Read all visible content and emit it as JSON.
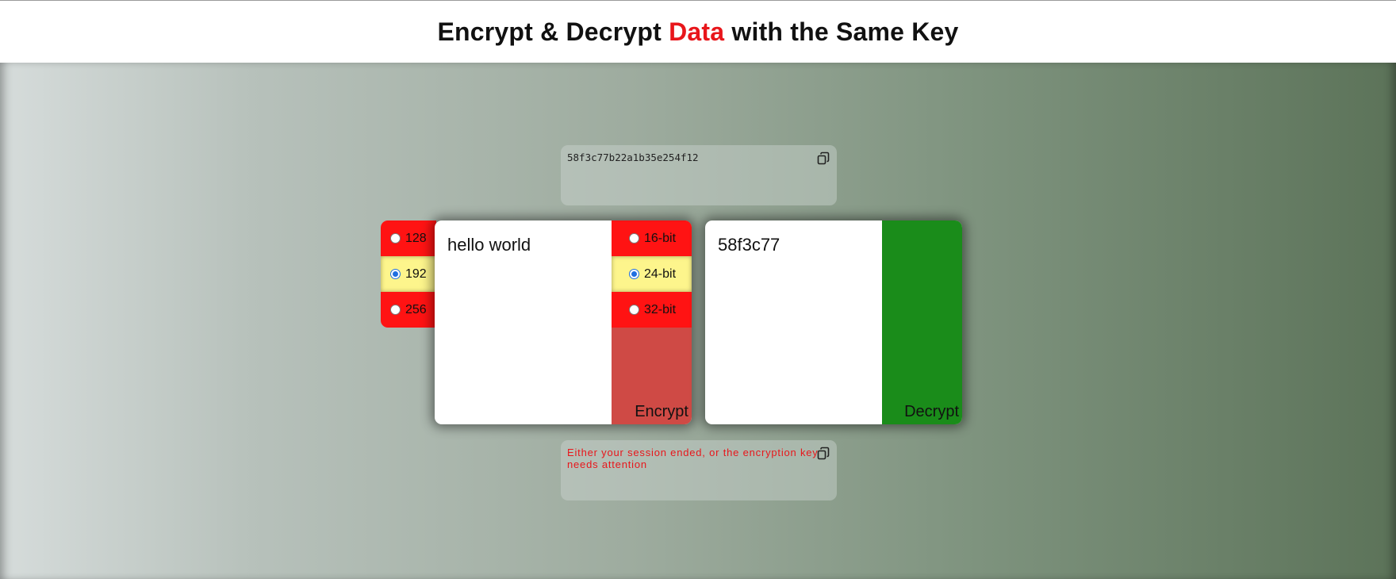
{
  "header": {
    "title_part1": "Encrypt & Decrypt ",
    "title_accent": "Data",
    "title_part2": " with the Same Key",
    "accent_color": "#e8161b"
  },
  "key": {
    "value": "58f3c77b22a1b35e254f12",
    "copy_icon": "copy-icon"
  },
  "status": {
    "message": "Either your session ended, or the encryption key needs attention",
    "copy_icon": "copy-icon"
  },
  "key_size": {
    "options": [
      "128",
      "192",
      "256"
    ],
    "selected": "192"
  },
  "encrypt": {
    "input_text": "hello world",
    "bit_options": [
      "16-bit",
      "24-bit",
      "32-bit"
    ],
    "selected_bits": "24-bit",
    "button_label": "Encrypt",
    "panel_color": "#ff1313"
  },
  "decrypt": {
    "input_text": "58f3c77",
    "button_label": "Decrypt",
    "panel_color": "#1a8c1a"
  },
  "colors": {
    "selected_option": "#fdf58c",
    "radio_checked": "#1f6fe0"
  }
}
